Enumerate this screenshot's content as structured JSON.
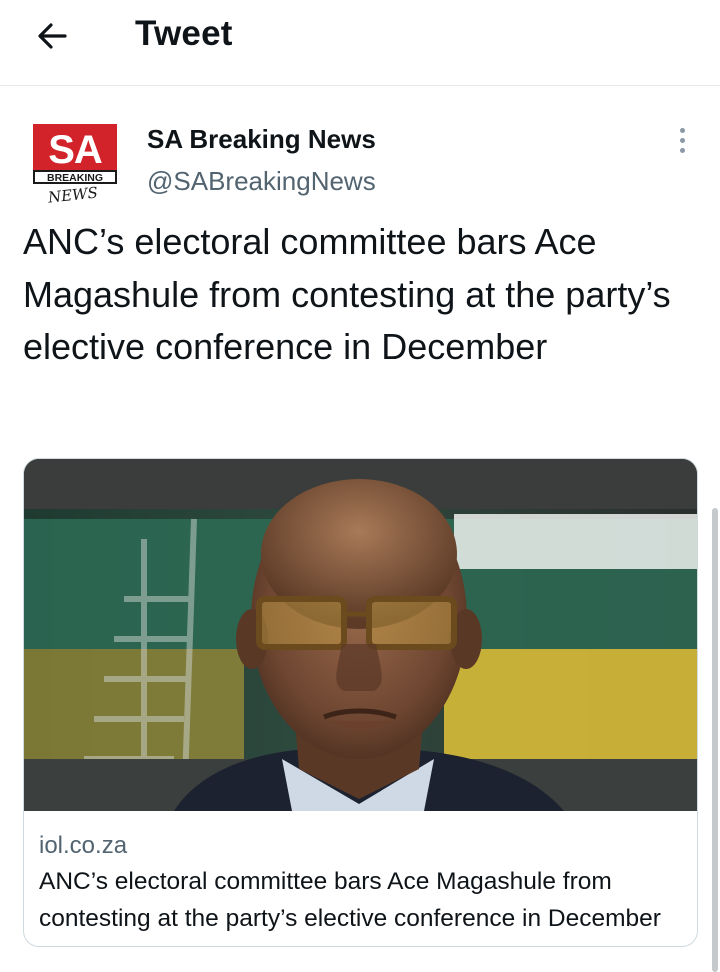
{
  "header": {
    "title": "Tweet",
    "back_icon": "arrow-left-icon"
  },
  "tweet": {
    "author": {
      "name": "SA Breaking News",
      "handle": "@SABreakingNews",
      "avatar": {
        "top_text": "SA",
        "banner_text": "BREAKING",
        "script_text": "NEWS"
      }
    },
    "more_icon": "more-vertical-icon",
    "text": "ANC’s electoral committee bars Ace Magashule from contesting at the party’s elective conference in December",
    "card": {
      "domain": "iol.co.za",
      "title": "ANC’s electoral committee bars Ace Magashule from contesting at the party’s elective conference in December"
    }
  },
  "colors": {
    "text_primary": "#0f1419",
    "text_secondary": "#536471",
    "border": "#cfd9de",
    "brand_red": "#d2232a"
  }
}
